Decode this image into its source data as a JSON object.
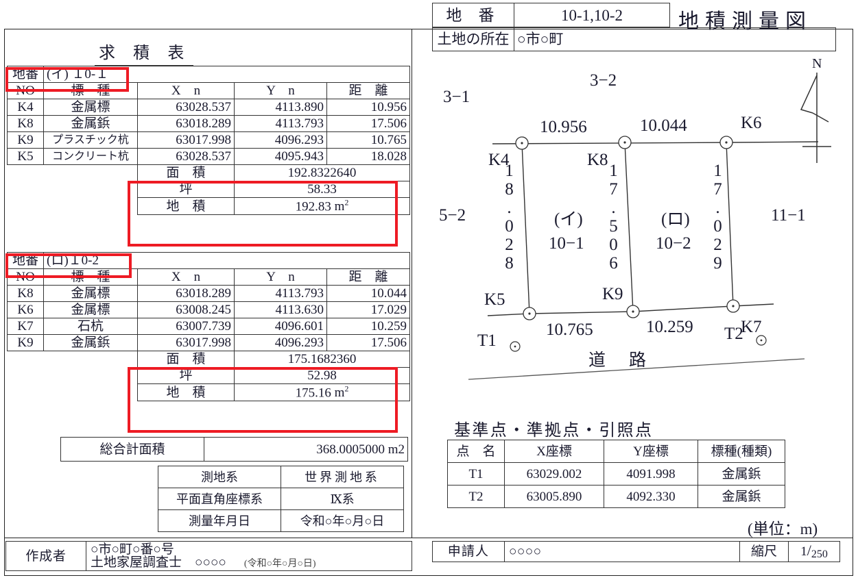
{
  "header": {
    "chiban_label": "地 番",
    "chiban_value": "10-1,10-2",
    "doc_title": "地積測量図",
    "location_label": "土地の所在",
    "location_value": "○市○町"
  },
  "kyuseki": {
    "title": "求 積 表",
    "columns": [
      "NO",
      "標　種",
      "X　n",
      "Y　n",
      "距　離"
    ],
    "chiban_label": "地番",
    "blocks": [
      {
        "chiban_value": "(イ) １0-１",
        "rows": [
          {
            "no": "K4",
            "hyoshu": "金属標",
            "xn": "63028.537",
            "yn": "4113.890",
            "dist": "10.956"
          },
          {
            "no": "K8",
            "hyoshu": "金属鋲",
            "xn": "63018.289",
            "yn": "4113.793",
            "dist": "17.506"
          },
          {
            "no": "K9",
            "hyoshu": "プラスチック杭",
            "xn": "63017.998",
            "yn": "4096.293",
            "dist": "10.765"
          },
          {
            "no": "K5",
            "hyoshu": "コンクリート杭",
            "xn": "63028.537",
            "yn": "4095.943",
            "dist": "18.028"
          }
        ],
        "summary": [
          {
            "label": "面　積",
            "value": "192.8322640",
            "unit": ""
          },
          {
            "label": "坪",
            "value": "58.33",
            "unit": ""
          },
          {
            "label": "地　積",
            "value": "192.83",
            "unit": "m"
          }
        ]
      },
      {
        "chiban_value": "(ロ)１0-2",
        "rows": [
          {
            "no": "K8",
            "hyoshu": "金属標",
            "xn": "63018.289",
            "yn": "4113.793",
            "dist": "10.044"
          },
          {
            "no": "K6",
            "hyoshu": "金属標",
            "xn": "63008.245",
            "yn": "4113.630",
            "dist": "17.029"
          },
          {
            "no": "K7",
            "hyoshu": "石杭",
            "xn": "63007.739",
            "yn": "4096.601",
            "dist": "10.259"
          },
          {
            "no": "K9",
            "hyoshu": "金属鋲",
            "xn": "63017.998",
            "yn": "4096.293",
            "dist": "17.506"
          }
        ],
        "summary": [
          {
            "label": "面　積",
            "value": "175.1682360",
            "unit": ""
          },
          {
            "label": "坪",
            "value": "52.98",
            "unit": ""
          },
          {
            "label": "地　積",
            "value": "175.16",
            "unit": "m"
          }
        ]
      }
    ],
    "total": {
      "label": "総合計面積",
      "value": "368.0005000 m2"
    }
  },
  "system_table": {
    "rows": [
      {
        "label": "測地系",
        "value": "世界測地系"
      },
      {
        "label": "平面直角座標系",
        "value": "Ⅸ系"
      },
      {
        "label": "測量年月日",
        "value": "令和○年○月○日"
      }
    ]
  },
  "author": {
    "label": "作成者",
    "address": "○市○町○番○号",
    "name_line": "土地家屋調査士　○○○○",
    "date": "(令和○年○月○日)"
  },
  "diagram": {
    "north_label": "N",
    "road_label": "道　路",
    "parcels": [
      {
        "mark": "(イ)",
        "chiban": "10−1"
      },
      {
        "mark": "(ロ)",
        "chiban": "10−2"
      }
    ],
    "neighbors": [
      "3−1",
      "3−2",
      "5−2",
      "11−1"
    ],
    "points": [
      "K4",
      "K8",
      "K6",
      "K5",
      "K9",
      "K7",
      "T1",
      "T2"
    ],
    "edge_lengths": {
      "top_left": "10.956",
      "top_right": "10.044",
      "left": "18.028",
      "middle": "17.506",
      "right": "17.029",
      "bottom_left": "10.765",
      "bottom_right": "10.259"
    }
  },
  "reference_points": {
    "title": "基準点・準拠点・引照点",
    "columns": [
      "点　名",
      "X座標",
      "Y座標",
      "標種(種類)"
    ],
    "rows": [
      {
        "name": "T1",
        "x": "63029.002",
        "y": "4091.998",
        "kind": "金属鋲"
      },
      {
        "name": "T2",
        "x": "63005.890",
        "y": "4092.330",
        "kind": "金属鋲"
      }
    ]
  },
  "unit_note": "(単位：m)",
  "applicant": {
    "label": "申請人",
    "value": "○○○○",
    "scale_label": "縮尺",
    "scale_numerator": "1",
    "scale_slash": "/",
    "scale_denominator": "250"
  },
  "colors": {
    "highlight": "#ee1b24",
    "ink": "#1a1a2e",
    "rule": "#333333"
  }
}
